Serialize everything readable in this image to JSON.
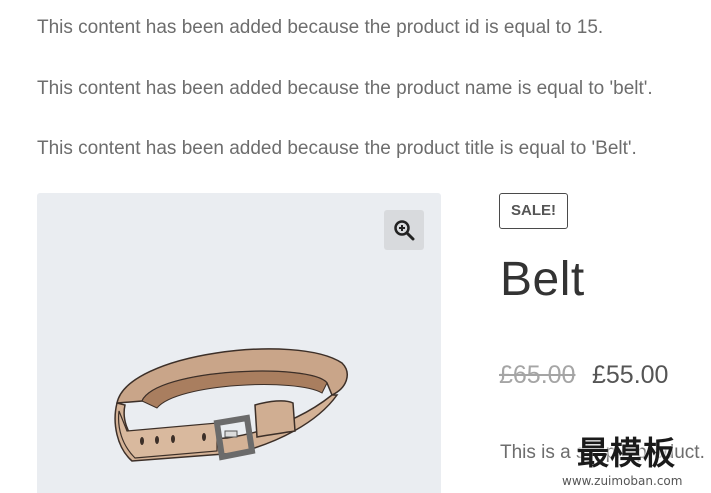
{
  "notices": [
    "This content has been added because the product id is equal to 15.",
    "This content has been added because the product name is equal to 'belt'.",
    "This content has been added because the product title is equal to 'Belt'."
  ],
  "product": {
    "badge": "SALE!",
    "title": "Belt",
    "regular_price": "£65.00",
    "sale_price": "£55.00",
    "short_description": "This is a simple product.",
    "image_icon": "belt-image",
    "zoom_icon": "zoom-in-icon"
  },
  "watermark": {
    "text": "最模板",
    "url": "www.zuimoban.com"
  },
  "colors": {
    "gallery_bg": "#eaedf1",
    "text": "#6d6d6d",
    "title": "#333333",
    "old_price": "#a5a5a5"
  }
}
